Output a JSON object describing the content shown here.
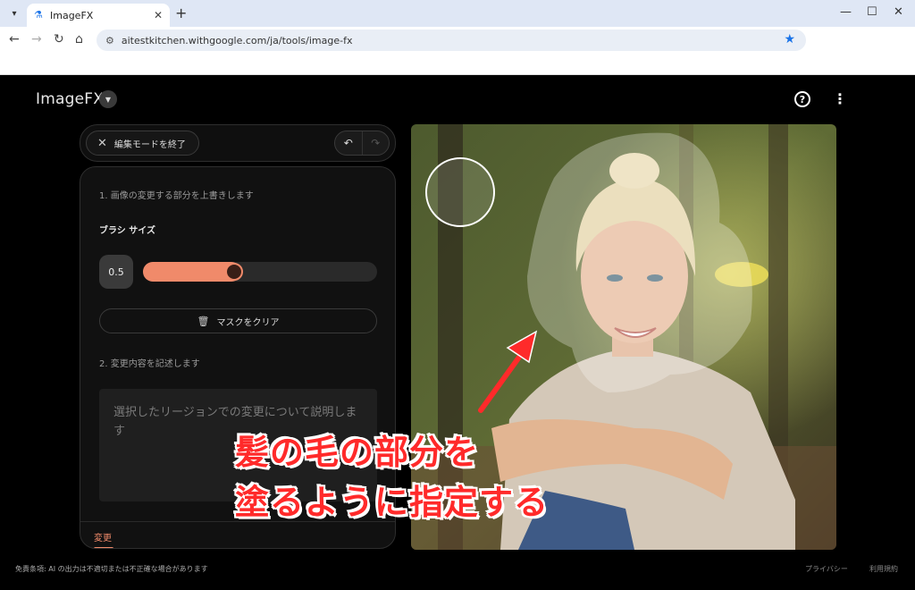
{
  "browser": {
    "tab_title": "ImageFX",
    "url": "aitestkitchen.withgoogle.com/ja/tools/image-fx"
  },
  "app": {
    "name": "ImageFX"
  },
  "toolbar": {
    "exit_label": "編集モードを終了"
  },
  "panel": {
    "step1": "1. 画像の変更する部分を上書きします",
    "brush_label": "ブラシ サイズ",
    "brush_value": "0.5",
    "brush_level_fraction": 0.42,
    "clear_label": "マスクをクリア",
    "step2": "2. 変更内容を記述します",
    "description_placeholder": "選択したリージョンでの変更について説明します",
    "tab_label": "変更"
  },
  "annotation": {
    "line1": "髪の毛の部分を",
    "line2": "塗るように指定する"
  },
  "footer": {
    "disclaimer": "免責条項: AI の出力は不適切または不正確な場合があります",
    "privacy": "プライバシー",
    "terms": "利用規約"
  },
  "colors": {
    "accent": "#f08a6a",
    "annotation": "#ff2a2a"
  }
}
